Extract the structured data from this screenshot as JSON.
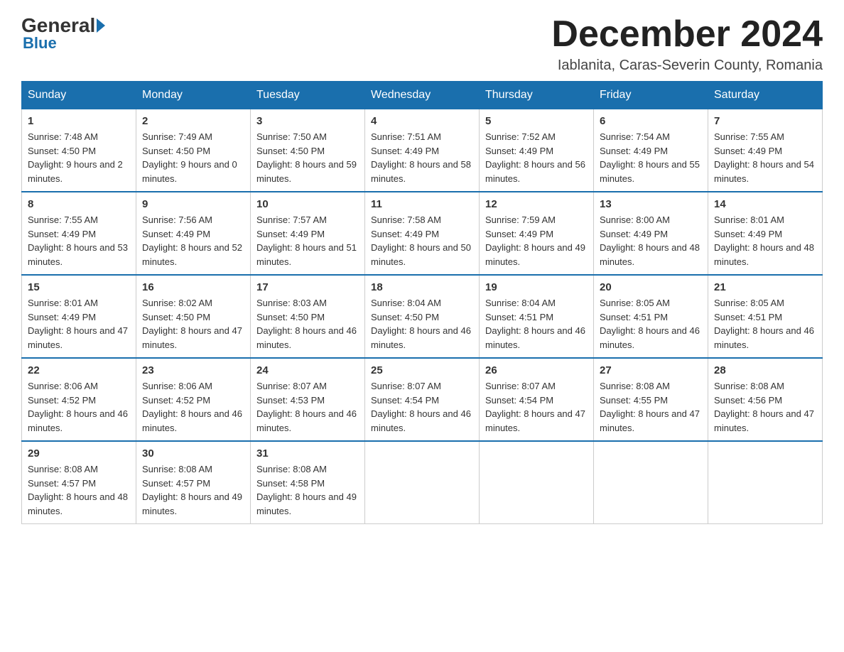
{
  "header": {
    "logo_general": "General",
    "logo_blue": "Blue",
    "month_year": "December 2024",
    "location": "Iablanita, Caras-Severin County, Romania"
  },
  "days_of_week": [
    "Sunday",
    "Monday",
    "Tuesday",
    "Wednesday",
    "Thursday",
    "Friday",
    "Saturday"
  ],
  "weeks": [
    [
      {
        "day": "1",
        "sunrise": "7:48 AM",
        "sunset": "4:50 PM",
        "daylight": "9 hours and 2 minutes."
      },
      {
        "day": "2",
        "sunrise": "7:49 AM",
        "sunset": "4:50 PM",
        "daylight": "9 hours and 0 minutes."
      },
      {
        "day": "3",
        "sunrise": "7:50 AM",
        "sunset": "4:50 PM",
        "daylight": "8 hours and 59 minutes."
      },
      {
        "day": "4",
        "sunrise": "7:51 AM",
        "sunset": "4:49 PM",
        "daylight": "8 hours and 58 minutes."
      },
      {
        "day": "5",
        "sunrise": "7:52 AM",
        "sunset": "4:49 PM",
        "daylight": "8 hours and 56 minutes."
      },
      {
        "day": "6",
        "sunrise": "7:54 AM",
        "sunset": "4:49 PM",
        "daylight": "8 hours and 55 minutes."
      },
      {
        "day": "7",
        "sunrise": "7:55 AM",
        "sunset": "4:49 PM",
        "daylight": "8 hours and 54 minutes."
      }
    ],
    [
      {
        "day": "8",
        "sunrise": "7:55 AM",
        "sunset": "4:49 PM",
        "daylight": "8 hours and 53 minutes."
      },
      {
        "day": "9",
        "sunrise": "7:56 AM",
        "sunset": "4:49 PM",
        "daylight": "8 hours and 52 minutes."
      },
      {
        "day": "10",
        "sunrise": "7:57 AM",
        "sunset": "4:49 PM",
        "daylight": "8 hours and 51 minutes."
      },
      {
        "day": "11",
        "sunrise": "7:58 AM",
        "sunset": "4:49 PM",
        "daylight": "8 hours and 50 minutes."
      },
      {
        "day": "12",
        "sunrise": "7:59 AM",
        "sunset": "4:49 PM",
        "daylight": "8 hours and 49 minutes."
      },
      {
        "day": "13",
        "sunrise": "8:00 AM",
        "sunset": "4:49 PM",
        "daylight": "8 hours and 48 minutes."
      },
      {
        "day": "14",
        "sunrise": "8:01 AM",
        "sunset": "4:49 PM",
        "daylight": "8 hours and 48 minutes."
      }
    ],
    [
      {
        "day": "15",
        "sunrise": "8:01 AM",
        "sunset": "4:49 PM",
        "daylight": "8 hours and 47 minutes."
      },
      {
        "day": "16",
        "sunrise": "8:02 AM",
        "sunset": "4:50 PM",
        "daylight": "8 hours and 47 minutes."
      },
      {
        "day": "17",
        "sunrise": "8:03 AM",
        "sunset": "4:50 PM",
        "daylight": "8 hours and 46 minutes."
      },
      {
        "day": "18",
        "sunrise": "8:04 AM",
        "sunset": "4:50 PM",
        "daylight": "8 hours and 46 minutes."
      },
      {
        "day": "19",
        "sunrise": "8:04 AM",
        "sunset": "4:51 PM",
        "daylight": "8 hours and 46 minutes."
      },
      {
        "day": "20",
        "sunrise": "8:05 AM",
        "sunset": "4:51 PM",
        "daylight": "8 hours and 46 minutes."
      },
      {
        "day": "21",
        "sunrise": "8:05 AM",
        "sunset": "4:51 PM",
        "daylight": "8 hours and 46 minutes."
      }
    ],
    [
      {
        "day": "22",
        "sunrise": "8:06 AM",
        "sunset": "4:52 PM",
        "daylight": "8 hours and 46 minutes."
      },
      {
        "day": "23",
        "sunrise": "8:06 AM",
        "sunset": "4:52 PM",
        "daylight": "8 hours and 46 minutes."
      },
      {
        "day": "24",
        "sunrise": "8:07 AM",
        "sunset": "4:53 PM",
        "daylight": "8 hours and 46 minutes."
      },
      {
        "day": "25",
        "sunrise": "8:07 AM",
        "sunset": "4:54 PM",
        "daylight": "8 hours and 46 minutes."
      },
      {
        "day": "26",
        "sunrise": "8:07 AM",
        "sunset": "4:54 PM",
        "daylight": "8 hours and 47 minutes."
      },
      {
        "day": "27",
        "sunrise": "8:08 AM",
        "sunset": "4:55 PM",
        "daylight": "8 hours and 47 minutes."
      },
      {
        "day": "28",
        "sunrise": "8:08 AM",
        "sunset": "4:56 PM",
        "daylight": "8 hours and 47 minutes."
      }
    ],
    [
      {
        "day": "29",
        "sunrise": "8:08 AM",
        "sunset": "4:57 PM",
        "daylight": "8 hours and 48 minutes."
      },
      {
        "day": "30",
        "sunrise": "8:08 AM",
        "sunset": "4:57 PM",
        "daylight": "8 hours and 49 minutes."
      },
      {
        "day": "31",
        "sunrise": "8:08 AM",
        "sunset": "4:58 PM",
        "daylight": "8 hours and 49 minutes."
      },
      null,
      null,
      null,
      null
    ]
  ]
}
